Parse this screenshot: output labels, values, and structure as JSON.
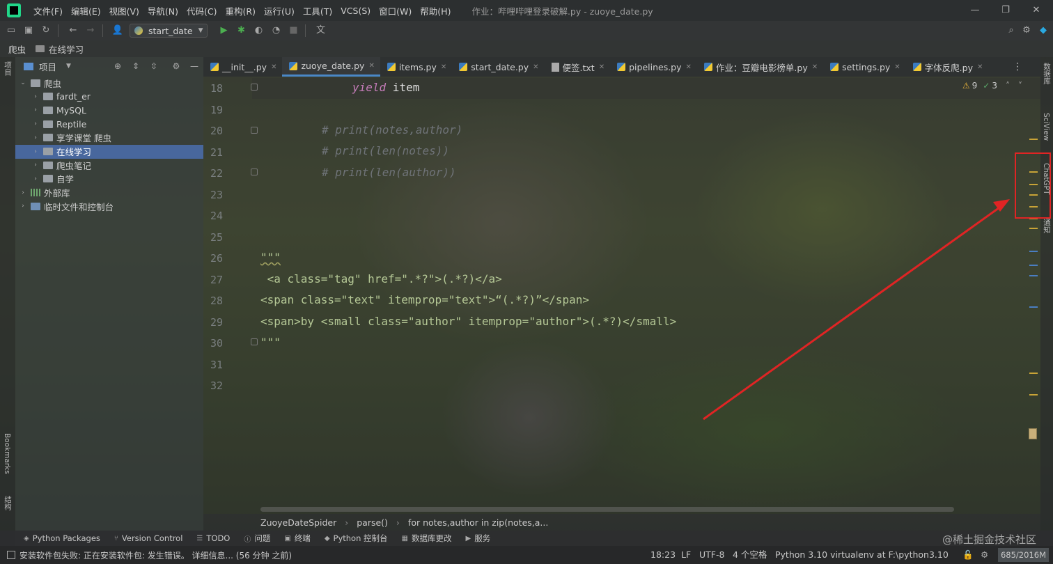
{
  "menu": {
    "items": [
      "文件(F)",
      "编辑(E)",
      "视图(V)",
      "导航(N)",
      "代码(C)",
      "重构(R)",
      "运行(U)",
      "工具(T)",
      "VCS(S)",
      "窗口(W)",
      "帮助(H)"
    ],
    "window_title": "作业：哔哩哔哩登录破解.py - zuoye_date.py"
  },
  "toolbar": {
    "run_config": "start_date"
  },
  "breadcrumb": {
    "root": "爬虫",
    "current": "在线学习"
  },
  "left_stripe": {
    "project": "项目",
    "bookmarks": "Bookmarks",
    "structure": "结构"
  },
  "project_panel": {
    "title": "项目",
    "tree": [
      {
        "label": "爬虫",
        "depth": 0,
        "expanded": true,
        "type": "folder"
      },
      {
        "label": "fardt_er",
        "depth": 1,
        "type": "folder"
      },
      {
        "label": "MySQL",
        "depth": 1,
        "type": "folder"
      },
      {
        "label": "Reptile",
        "depth": 1,
        "type": "folder"
      },
      {
        "label": "享学课堂 爬虫",
        "depth": 1,
        "type": "folder"
      },
      {
        "label": "在线学习",
        "depth": 1,
        "type": "folder",
        "selected": true
      },
      {
        "label": "爬虫笔记",
        "depth": 1,
        "type": "folder"
      },
      {
        "label": "自学",
        "depth": 1,
        "type": "folder"
      },
      {
        "label": "外部库",
        "depth": 0,
        "type": "lib"
      },
      {
        "label": "临时文件和控制台",
        "depth": 0,
        "type": "scratch"
      }
    ]
  },
  "tabs": [
    {
      "label": "__init__.py",
      "icon": "python"
    },
    {
      "label": "zuoye_date.py",
      "icon": "python",
      "active": true
    },
    {
      "label": "items.py",
      "icon": "python"
    },
    {
      "label": "start_date.py",
      "icon": "python"
    },
    {
      "label": "便签.txt",
      "icon": "text"
    },
    {
      "label": "pipelines.py",
      "icon": "python"
    },
    {
      "label": "作业：豆瓣电影榜单.py",
      "icon": "python"
    },
    {
      "label": "settings.py",
      "icon": "python"
    },
    {
      "label": "字体反爬.py",
      "icon": "python"
    }
  ],
  "inspections": {
    "warnings": "9",
    "ok": "3"
  },
  "editor": {
    "line_numbers": [
      "18",
      "19",
      "20",
      "21",
      "22",
      "23",
      "24",
      "25",
      "26",
      "27",
      "28",
      "29",
      "30",
      "31",
      "32"
    ],
    "lines": {
      "l18_kw": "yield",
      "l18_rest": " item",
      "l20": "# print(notes,author)",
      "l21": "# print(len(notes))",
      "l22": "# print(len(author))",
      "l26": "\"\"\"",
      "l27": " <a class=\"tag\" href=\".*?\">(.*?)</a>",
      "l28": "<span class=\"text\" itemprop=\"text\">“(.*?)”</span>",
      "l29": "<span>by <small class=\"author\" itemprop=\"author\">(.*?)</small>",
      "l30": "\"\"\""
    }
  },
  "editor_crumbs": [
    "ZuoyeDateSpider",
    "parse()",
    "for notes,author in zip(notes,a..."
  ],
  "right_stripe": {
    "database": "数据库",
    "sciview": "SciView",
    "chatgpt": "ChatGPT",
    "notifications": "通知"
  },
  "toolwindows": [
    {
      "label": "Python Packages",
      "icon": "layers-icon"
    },
    {
      "label": "Version Control",
      "icon": "branch-icon"
    },
    {
      "label": "TODO",
      "icon": "list-icon"
    },
    {
      "label": "问题",
      "icon": "info-icon"
    },
    {
      "label": "终端",
      "icon": "terminal-icon"
    },
    {
      "label": "Python 控制台",
      "icon": "python-icon"
    },
    {
      "label": "数据库更改",
      "icon": "database-icon"
    },
    {
      "label": "服务",
      "icon": "play-icon"
    }
  ],
  "watermark": "@稀土掘金技术社区",
  "status": {
    "message": "安装软件包失败: 正在安装软件包: 发生错误。 详细信息... (56 分钟 之前)",
    "position": "18:23",
    "line_sep": "LF",
    "encoding": "UTF-8",
    "indent": "4 个空格",
    "interpreter": "Python 3.10 virtualenv at F:\\python3.10",
    "memory": "685/2016M"
  },
  "colors": {
    "accent": "#4a88c7",
    "selection": "#4b6eaf",
    "highlight_box": "#e02424",
    "string": "#b5c896",
    "keyword": "#cc7832"
  }
}
